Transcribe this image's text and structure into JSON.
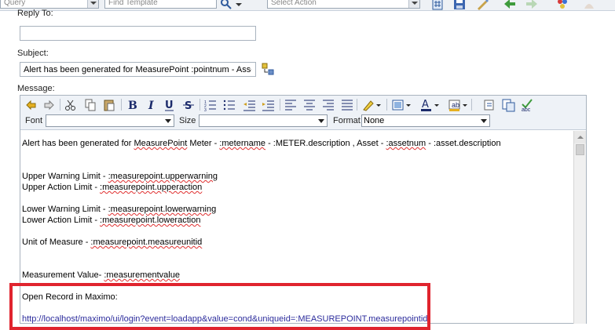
{
  "toolbar": {
    "query_value": "Query",
    "find_template_placeholder": "Find Template",
    "select_action_placeholder": "Select Action"
  },
  "form": {
    "reply_to_label": "Reply To:",
    "reply_to_value": "",
    "subject_label": "Subject:",
    "subject_value": "Alert has been generated for MeasurePoint :pointnum - Asset",
    "message_label": "Message:"
  },
  "editor": {
    "font_label": "Font",
    "font_value": "",
    "size_label": "Size",
    "size_value": "",
    "format_label": "Format",
    "format_value": "None",
    "body": {
      "line1_a": "Alert has been generated for ",
      "line1_b": "MeasurePoint",
      "line1_c": " Meter - ",
      "line1_d": ":metername",
      "line1_e": " - :METER.description  , Asset - ",
      "line1_f": ":assetnum",
      "line1_g": " - :asset.description",
      "uw_a": "Upper Warning Limit - ",
      "uw_b": ":measurepoint.upperwarning",
      "ua_a": "Upper Action Limit - ",
      "ua_b": ":measurepoint.upperaction",
      "lw_a": "Lower Warning Limit - ",
      "lw_b": ":measurepoint.lowerwarning",
      "la_a": "Lower Action Limit - ",
      "la_b": ":measurepoint.loweraction",
      "uom_a": "Unit of Measure - ",
      "uom_b": ":measurepoint.measureunitid",
      "mv_a": "Measurement Value- ",
      "mv_b": ":measurementvalue",
      "open_record": "Open Record in Maximo:",
      "url": "http://localhost/maximo/ui/login?event=loadapp&value=cond&uniqueid=:MEASUREPOINT.measurepointid"
    }
  },
  "colors": {
    "highlight_border": "#e0242e",
    "link": "#2c2c9c"
  }
}
